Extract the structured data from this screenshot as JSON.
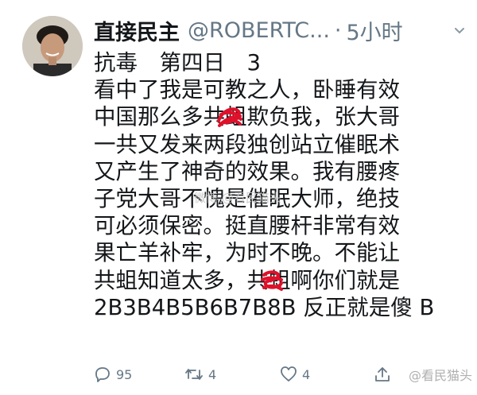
{
  "tweet": {
    "display_name": "直接民主",
    "handle": "@ROBERTC...",
    "separator": "·",
    "time": "5小时",
    "lines": [
      "抗毒　第四日　3",
      "看中了我是可教之人，卧睡有效",
      "中国那么多共蛆欺负我，张大哥",
      "一共又发来两段独创站立催眠术",
      "又产生了神奇的效果。我有腰疼",
      "子党大哥不愧是催眠大师，绝技",
      "可必须保密。挺直腰杆非常有效",
      "果亡羊补牢，为时不晚。不能让",
      "共蛆知道太多，共蛆啊你们就是",
      "2B3B4B5B6B7B8B 反正就是傻 B"
    ],
    "replies_count": "95",
    "retweets_count": "4",
    "likes_count": "4"
  },
  "watermarks": {
    "center": "微博 @看民猫头",
    "corner": "@看民猫头"
  },
  "icons": {
    "reply": "reply-icon",
    "retweet": "retweet-icon",
    "like": "heart-icon",
    "share": "share-icon",
    "more": "chevron-down-icon"
  },
  "colors": {
    "text": "#14171a",
    "secondary": "#657786",
    "scribble": "#e0102a"
  }
}
